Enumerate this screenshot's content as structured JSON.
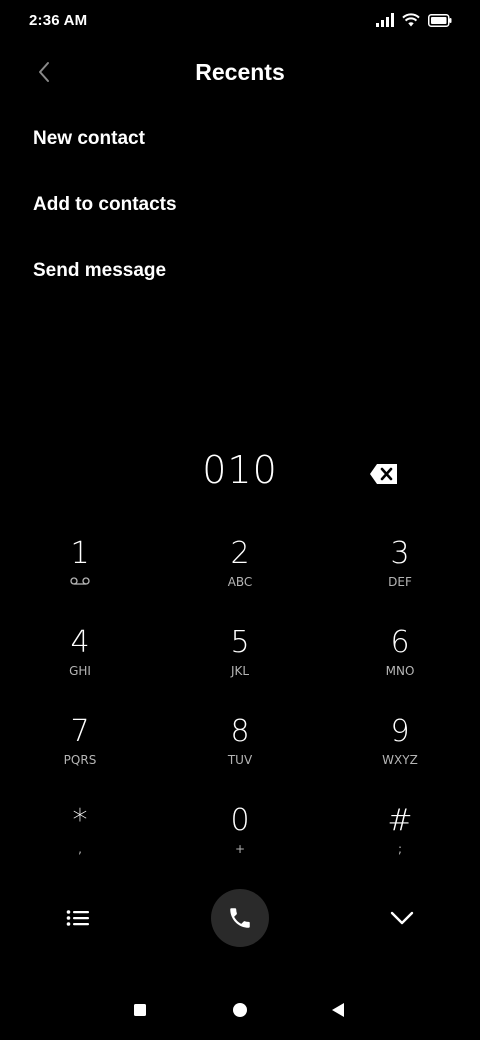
{
  "status_bar": {
    "time": "2:36 AM",
    "icons": [
      "signal-icon",
      "wifi-icon",
      "battery-icon"
    ]
  },
  "header": {
    "title": "Recents",
    "back_icon": "chevron-left-icon"
  },
  "menu": [
    {
      "label": "New contact"
    },
    {
      "label": "Add to contacts"
    },
    {
      "label": "Send message"
    }
  ],
  "dialer": {
    "number": "010",
    "keys": [
      {
        "digit": "1",
        "letters": ""
      },
      {
        "digit": "2",
        "letters": "ABC"
      },
      {
        "digit": "3",
        "letters": "DEF"
      },
      {
        "digit": "4",
        "letters": "GHI"
      },
      {
        "digit": "5",
        "letters": "JKL"
      },
      {
        "digit": "6",
        "letters": "MNO"
      },
      {
        "digit": "7",
        "letters": "PQRS"
      },
      {
        "digit": "8",
        "letters": "TUV"
      },
      {
        "digit": "9",
        "letters": "WXYZ"
      },
      {
        "digit": "*",
        "letters": ","
      },
      {
        "digit": "0",
        "letters": "+"
      },
      {
        "digit": "#",
        "letters": ";"
      }
    ]
  },
  "nav_bar": {
    "icons": [
      "square-icon",
      "circle-icon",
      "triangle-back-icon"
    ]
  }
}
